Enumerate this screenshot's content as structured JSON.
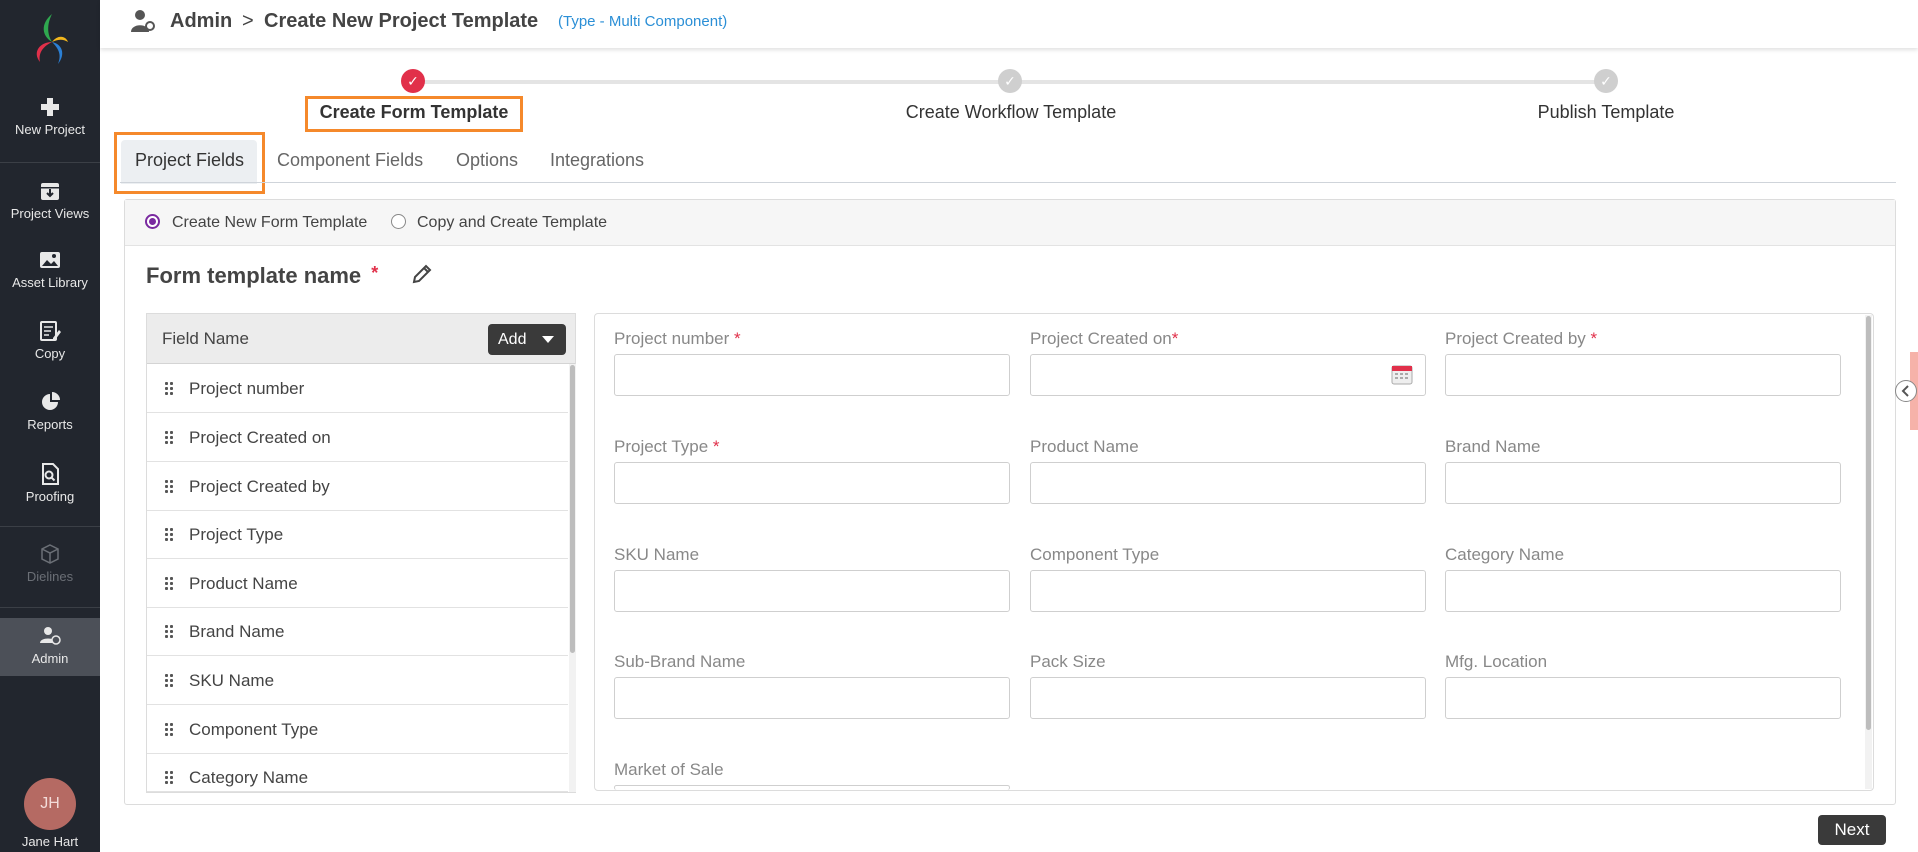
{
  "sidebar": {
    "items": [
      {
        "label": "New Project",
        "icon": "plus-icon"
      },
      {
        "label": "Project Views",
        "icon": "archive-box-icon"
      },
      {
        "label": "Asset Library",
        "icon": "image-icon"
      },
      {
        "label": "Copy",
        "icon": "edit-document-icon"
      },
      {
        "label": "Reports",
        "icon": "pie-chart-icon"
      },
      {
        "label": "Proofing",
        "icon": "search-document-icon"
      },
      {
        "label": "Dielines",
        "icon": "cube-icon"
      },
      {
        "label": "Admin",
        "icon": "user-settings-icon"
      }
    ],
    "user": {
      "initials": "JH",
      "name": "Jane Hart"
    }
  },
  "header": {
    "crumb_root": "Admin",
    "separator": ">",
    "crumb_page": "Create New Project Template",
    "type_label": "(Type - Multi Component)"
  },
  "stepper": {
    "steps": [
      {
        "label": "Create Form Template",
        "state": "done"
      },
      {
        "label": "Create Workflow Template",
        "state": "pending"
      },
      {
        "label": "Publish Template",
        "state": "pending"
      }
    ]
  },
  "tabs": [
    "Project Fields",
    "Component Fields",
    "Options",
    "Integrations"
  ],
  "mode": {
    "options": [
      "Create New Form Template",
      "Copy and Create Template"
    ],
    "selected": "Create New Form Template"
  },
  "form": {
    "name_label": "Form template name",
    "required_mark": "*"
  },
  "field_list": {
    "header": "Field Name",
    "add_label": "Add",
    "items": [
      "Project number",
      "Project Created on",
      "Project Created by",
      "Project Type",
      "Product Name",
      "Brand Name",
      "SKU Name",
      "Component Type",
      "Category Name"
    ]
  },
  "preview": {
    "fields": [
      {
        "label": "Project number",
        "required": "*"
      },
      {
        "label": "Project Created on",
        "required": "*"
      },
      {
        "label": "Project Created by",
        "required": "*"
      },
      {
        "label": "Project Type",
        "required": "*"
      },
      {
        "label": "Product Name",
        "required": ""
      },
      {
        "label": "Brand Name",
        "required": ""
      },
      {
        "label": "SKU Name",
        "required": ""
      },
      {
        "label": "Component Type",
        "required": ""
      },
      {
        "label": "Category Name",
        "required": ""
      },
      {
        "label": "Sub-Brand Name",
        "required": ""
      },
      {
        "label": "Pack Size",
        "required": ""
      },
      {
        "label": "Mfg. Location",
        "required": ""
      },
      {
        "label": "Market of Sale",
        "required": ""
      }
    ]
  },
  "footer": {
    "next_label": "Next"
  },
  "colors": {
    "accent_red": "#e1304a",
    "highlight_orange": "#f5892b",
    "sidebar_bg": "#22262e",
    "link_blue": "#2b8fd6"
  }
}
